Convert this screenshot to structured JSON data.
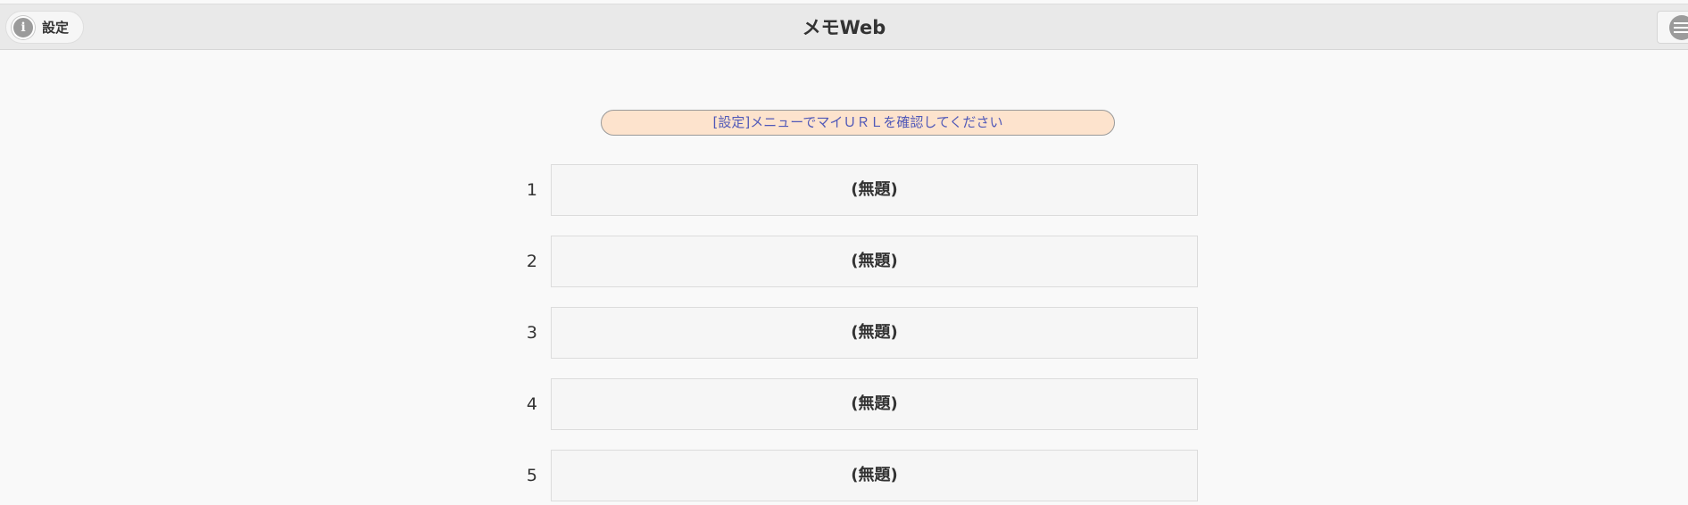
{
  "header": {
    "title": "メモWeb",
    "settings_label": "設定",
    "settings_icon": "info-icon",
    "menu_icon": "hamburger-menu-icon"
  },
  "notice": {
    "text": "[設定]メニューでマイＵＲＬを確認してください"
  },
  "memos": [
    {
      "number": "1",
      "title": "(無題)"
    },
    {
      "number": "2",
      "title": "(無題)"
    },
    {
      "number": "3",
      "title": "(無題)"
    },
    {
      "number": "4",
      "title": "(無題)"
    },
    {
      "number": "5",
      "title": "(無題)"
    }
  ],
  "colors": {
    "header_bg": "#e9e9e9",
    "page_bg": "#f9f9f9",
    "notice_bg": "#fde3cd",
    "notice_text": "#5159b8",
    "icon_gray": "#9b9b9b"
  }
}
